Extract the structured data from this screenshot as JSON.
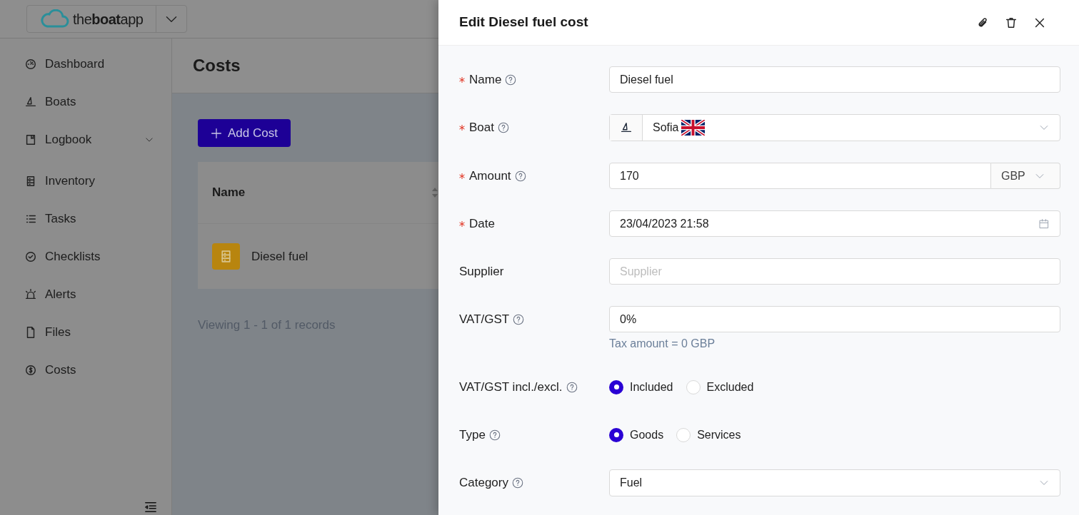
{
  "app": {
    "logo": "the**boat**app"
  },
  "sidebar": {
    "items": [
      {
        "label": "Dashboard",
        "expandable": false
      },
      {
        "label": "Boats",
        "expandable": false
      },
      {
        "label": "Logbook",
        "expandable": true
      },
      {
        "label": "Inventory",
        "expandable": false
      },
      {
        "label": "Tasks",
        "expandable": false
      },
      {
        "label": "Checklists",
        "expandable": false
      },
      {
        "label": "Alerts",
        "expandable": false
      },
      {
        "label": "Files",
        "expandable": false
      },
      {
        "label": "Costs",
        "expandable": false
      }
    ]
  },
  "page": {
    "title": "Costs",
    "add_button": "Add Cost",
    "table": {
      "columns": [
        "Name"
      ],
      "rows": [
        {
          "name": "Diesel fuel"
        }
      ]
    },
    "footer": "Viewing 1 - 1 of 1 records"
  },
  "drawer": {
    "title": "Edit Diesel fuel cost",
    "fields": [
      {
        "kind": "text",
        "label": "Name",
        "required": true,
        "help": true,
        "value": "Diesel fuel"
      },
      {
        "kind": "boat",
        "label": "Boat",
        "required": true,
        "help": true,
        "value": "Sofia"
      },
      {
        "kind": "amount",
        "label": "Amount",
        "required": true,
        "help": true,
        "value": "170",
        "currency": "GBP"
      },
      {
        "kind": "date",
        "label": "Date",
        "required": true,
        "help": false,
        "value": "23/04/2023 21:58"
      },
      {
        "kind": "text",
        "label": "Supplier",
        "required": false,
        "help": false,
        "placeholder": "Supplier"
      },
      {
        "kind": "text",
        "label": "VAT/GST",
        "required": false,
        "help": true,
        "value": "0%",
        "note": "Tax amount = 0 GBP"
      },
      {
        "kind": "radio",
        "label": "VAT/GST incl./excl.",
        "required": false,
        "help": true,
        "options": [
          {
            "label": "Included",
            "selected": true
          },
          {
            "label": "Excluded",
            "selected": false
          }
        ]
      },
      {
        "kind": "radio",
        "label": "Type",
        "required": false,
        "help": true,
        "options": [
          {
            "label": "Goods",
            "selected": true
          },
          {
            "label": "Services",
            "selected": false
          }
        ]
      },
      {
        "kind": "select",
        "label": "Category",
        "required": false,
        "help": true,
        "value": "Fuel"
      }
    ]
  }
}
